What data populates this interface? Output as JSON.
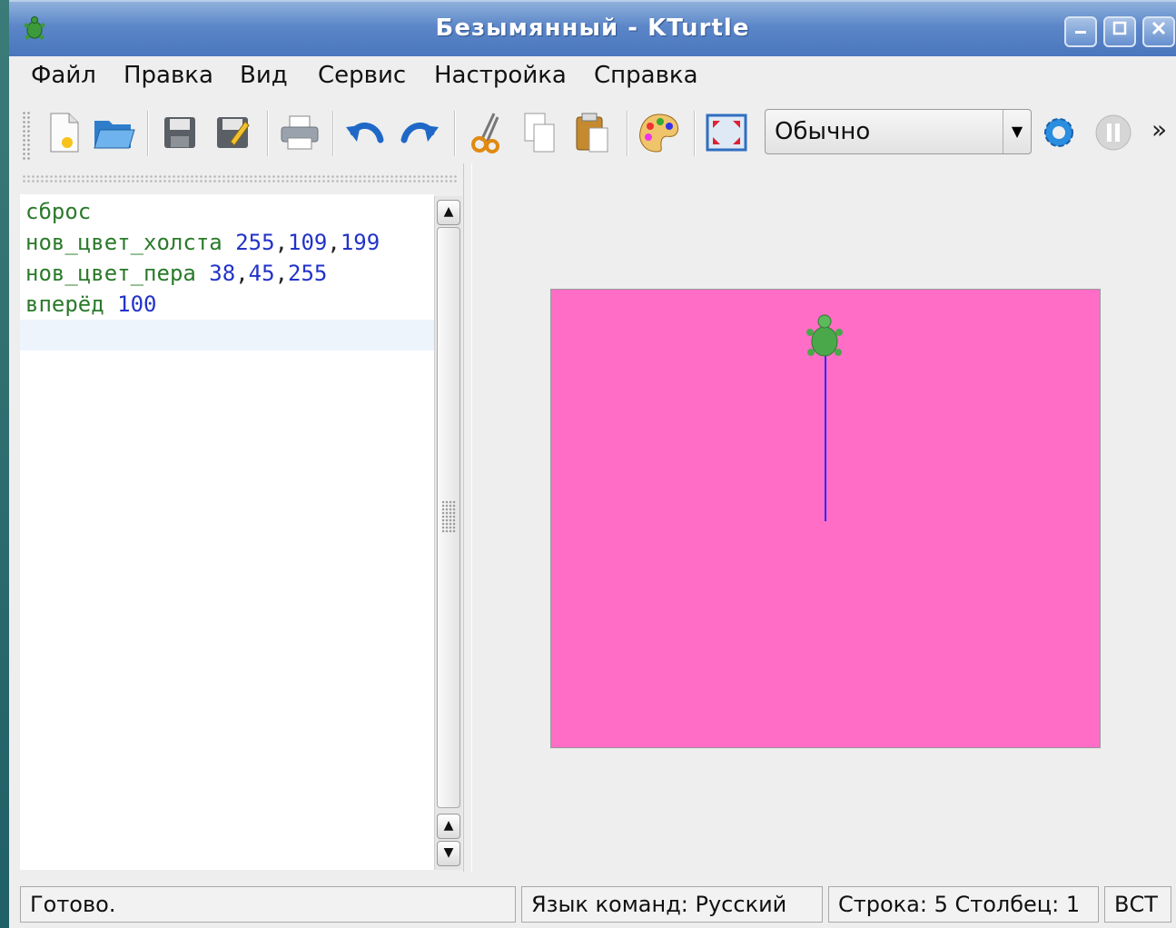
{
  "window": {
    "title": "Безымянный - KTurtle",
    "icon": "turtle-icon"
  },
  "menu": {
    "file": "Файл",
    "edit": "Правка",
    "view": "Вид",
    "tools": "Сервис",
    "settings": "Настройка",
    "help": "Справка"
  },
  "toolbar": {
    "buttons": [
      "new-file-icon",
      "open-folder-icon",
      "save-icon",
      "save-as-icon",
      "print-icon",
      "undo-icon",
      "redo-icon",
      "cut-icon",
      "copy-icon",
      "paste-icon",
      "palette-icon",
      "fullscreen-icon"
    ],
    "speed_value": "Обычно",
    "run_icon": "gear-icon",
    "pause_icon": "pause-icon",
    "more": "»"
  },
  "editor": {
    "lines": [
      {
        "cmd": "сброс",
        "args": ""
      },
      {
        "cmd": "нов_цвет_холста",
        "a1": "255",
        "a2": "109",
        "a3": "199"
      },
      {
        "cmd": "нов_цвет_пера",
        "a1": "38",
        "a2": "45",
        "a3": "255"
      },
      {
        "cmd": "вперёд",
        "a1": "100"
      }
    ]
  },
  "canvas": {
    "background": "#ff6dc7",
    "pen_color": "#262dff",
    "forward_distance": 100
  },
  "status": {
    "message": "Готово.",
    "language": "Язык команд: Русский",
    "position": "Строка: 5 Столбец: 1",
    "mode": "ВСТ"
  }
}
